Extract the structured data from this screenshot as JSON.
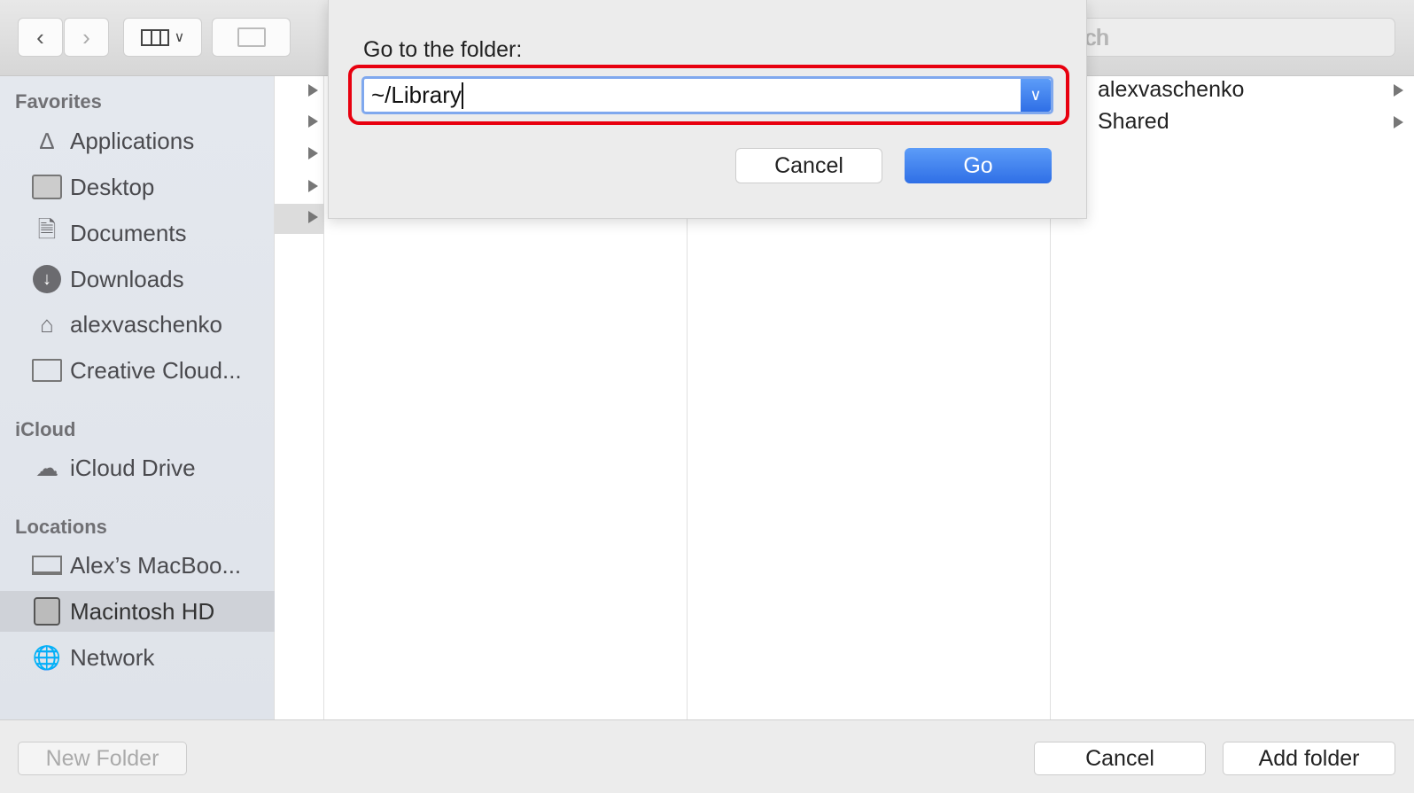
{
  "toolbar": {
    "back_icon": "chevron-left-icon",
    "forward_icon": "chevron-right-icon",
    "view_icon": "columns-view-icon",
    "new_folder_icon": "folder-plus-icon",
    "search_placeholder": "Search",
    "search_visible": "rch"
  },
  "sidebar": {
    "favorites_header": "Favorites",
    "favorites": [
      {
        "label": "Applications",
        "icon": "applications-icon"
      },
      {
        "label": "Desktop",
        "icon": "desktop-icon"
      },
      {
        "label": "Documents",
        "icon": "documents-icon"
      },
      {
        "label": "Downloads",
        "icon": "downloads-icon"
      },
      {
        "label": "alexvaschenko",
        "icon": "home-icon"
      },
      {
        "label": "Creative Cloud...",
        "icon": "folder-icon"
      }
    ],
    "icloud_header": "iCloud",
    "icloud": [
      {
        "label": "iCloud Drive",
        "icon": "cloud-icon"
      }
    ],
    "locations_header": "Locations",
    "locations": [
      {
        "label": "Alex’s MacBoo...",
        "icon": "laptop-icon"
      },
      {
        "label": "Macintosh HD",
        "icon": "disk-icon",
        "selected": true
      },
      {
        "label": "Network",
        "icon": "globe-icon"
      }
    ]
  },
  "columns": {
    "col4": [
      {
        "label": "alexvaschenko"
      },
      {
        "label": "Shared"
      }
    ]
  },
  "dialog": {
    "title": "Go to the folder:",
    "value": "~/Library",
    "cancel": "Cancel",
    "go": "Go",
    "highlight_color": "#e8000f",
    "accent": "#2f6fe6"
  },
  "bottom": {
    "new_folder": "New Folder",
    "cancel": "Cancel",
    "add_folder": "Add folder"
  }
}
